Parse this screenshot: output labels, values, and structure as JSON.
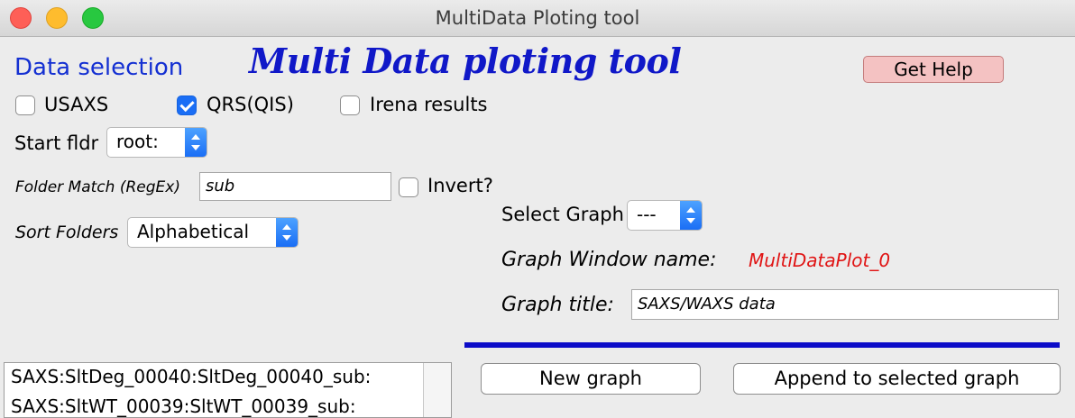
{
  "window": {
    "title": "MultiData Ploting tool"
  },
  "header": {
    "section_title": "Data selection",
    "main_title": "Multi Data ploting tool",
    "help_label": "Get Help"
  },
  "sources": [
    {
      "label": "USAXS",
      "checked": false
    },
    {
      "label": "QRS(QIS)",
      "checked": true
    },
    {
      "label": "Irena results",
      "checked": false
    }
  ],
  "start_folder": {
    "label": "Start fldr",
    "value": "root:"
  },
  "folder_match": {
    "label": "Folder Match (RegEx)",
    "value": "sub",
    "invert_label": "Invert?",
    "invert_checked": false
  },
  "sort": {
    "label": "Sort Folders",
    "value": "Alphabetical"
  },
  "graph": {
    "select_label": "Select Graph",
    "select_value": "---",
    "window_name_label": "Graph Window name:",
    "window_name": "MultiDataPlot_0",
    "title_label": "Graph title:",
    "title_value": "SAXS/WAXS data"
  },
  "buttons": {
    "new_graph": "New graph",
    "append": "Append to selected graph"
  },
  "folder_list": [
    "SAXS:SltDeg_00040:SltDeg_00040_sub:",
    "SAXS:SltWT_00039:SltWT_00039_sub:"
  ],
  "colors": {
    "section_title": "#1430d2",
    "main_title": "#1018c8",
    "window_name": "#e01414",
    "help_button": "#f4c2c2",
    "separator": "#0c0cc8",
    "checkbox_checked": "#1a6ef5"
  }
}
